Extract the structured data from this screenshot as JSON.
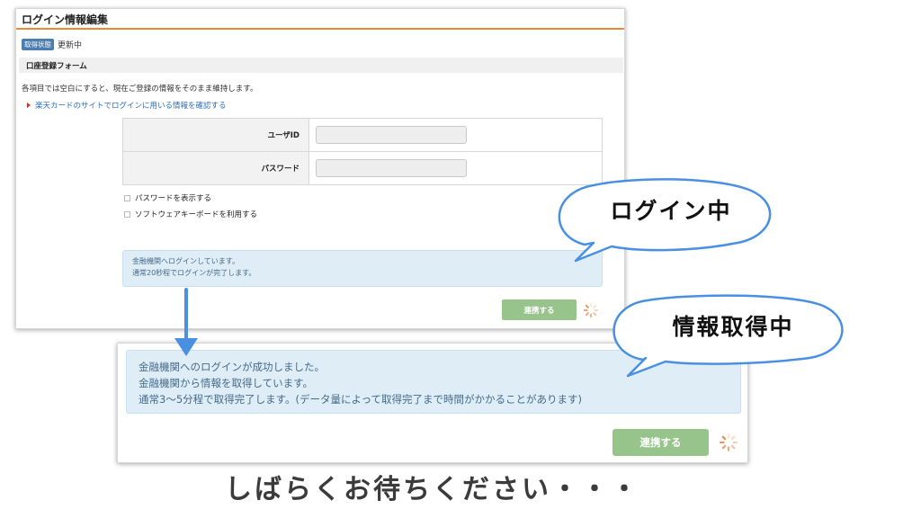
{
  "top_panel": {
    "title": "ログイン情報編集",
    "status_badge": "取得状態",
    "status_text": "更新中",
    "section_title": "口座登録フォーム",
    "note": "各項目では空白にすると、現在ご登録の情報をそのまま維持します。",
    "link_text": "楽天カードのサイトでログインに用いる情報を確認する",
    "fields": [
      {
        "label": "ユーザID",
        "value": ""
      },
      {
        "label": "パスワード",
        "value": ""
      }
    ],
    "checkboxes": [
      {
        "label": "パスワードを表示する",
        "checked": false
      },
      {
        "label": "ソフトウェアキーボードを利用する",
        "checked": false
      }
    ],
    "info_lines": [
      "金融機関へログインしています。",
      "通常20秒程でログインが完了します。"
    ],
    "button_label": "連携する"
  },
  "bottom_panel": {
    "info_lines": [
      "金融機関へのログインが成功しました。",
      "金融機関から情報を取得しています。",
      "通常3〜5分程で取得完了します。(データ量によって取得完了まで時間がかかることがあります)"
    ],
    "button_label": "連携する"
  },
  "bubbles": {
    "login": "ログイン中",
    "fetching": "情報取得中"
  },
  "caption": "しばらくお待ちください・・・",
  "colors": {
    "accent_orange": "#e88a3a",
    "info_background": "#deedf6",
    "info_text": "#456a8a",
    "button_green": "#97c48a",
    "link_blue": "#2a6ebf",
    "bubble_outline": "#4a90e2",
    "spinner": "#e8894a"
  }
}
